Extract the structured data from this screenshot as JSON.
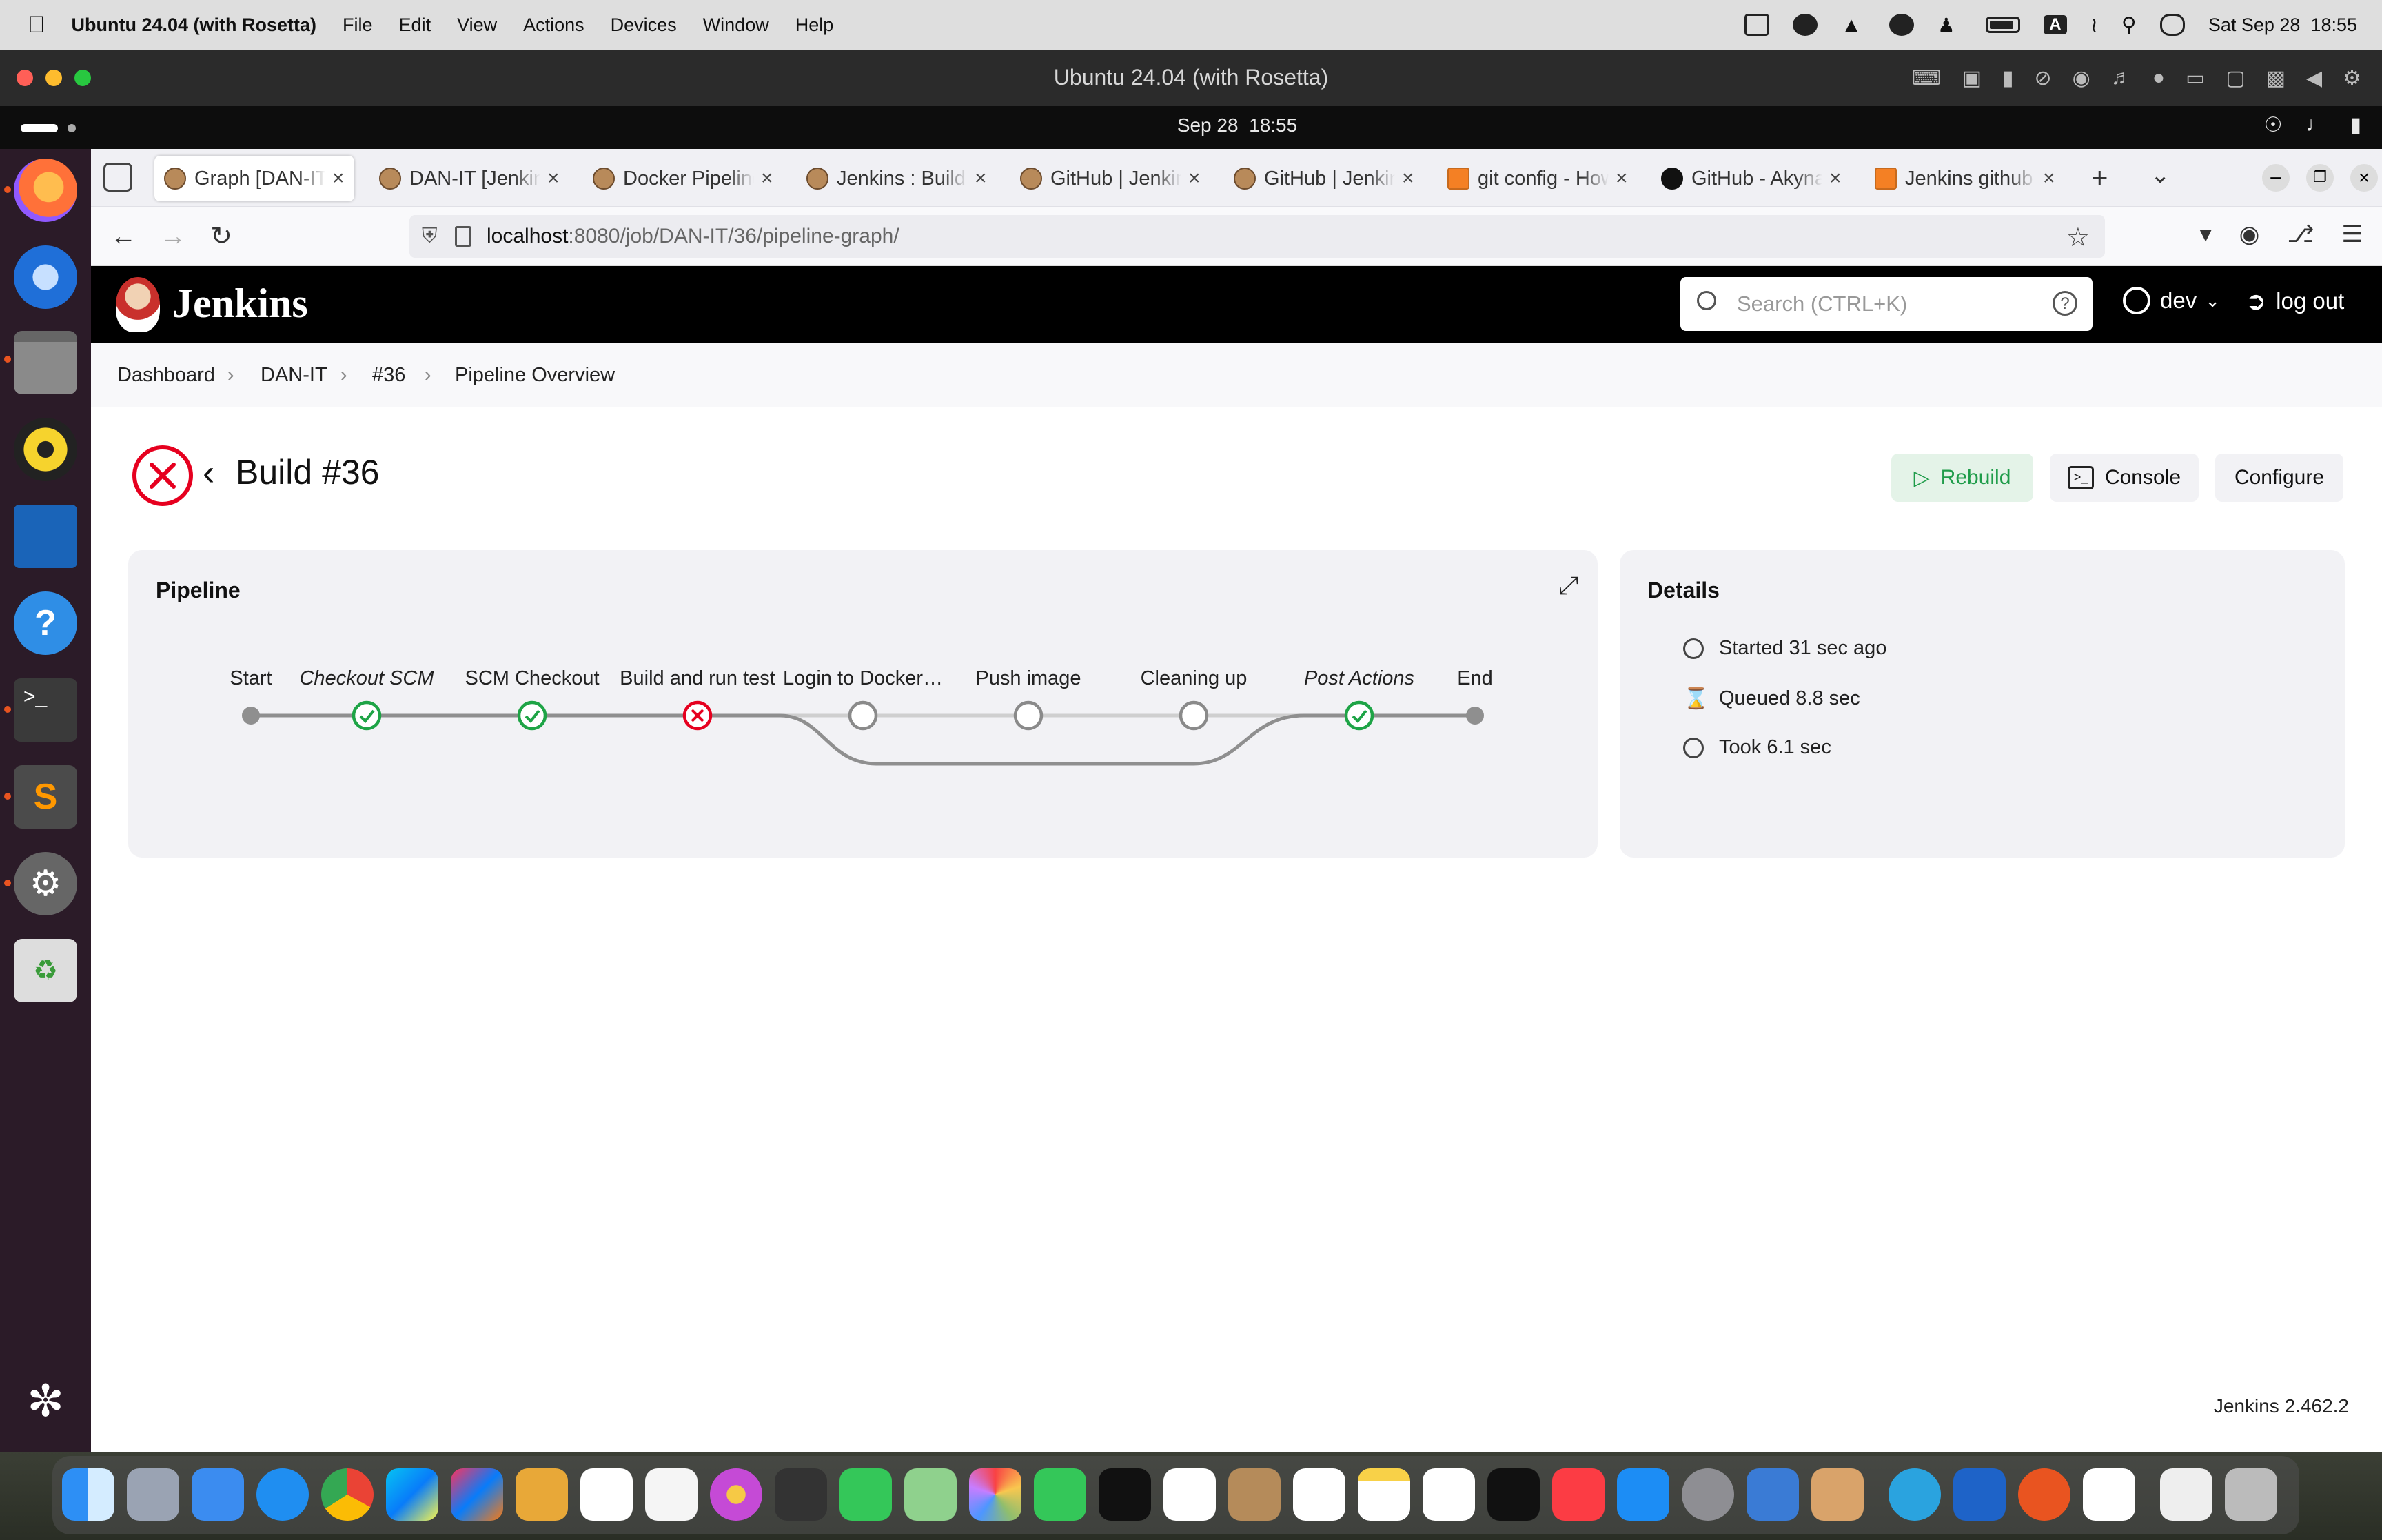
{
  "mac_menubar": {
    "app_name": "Ubuntu 24.04 (with Rosetta)",
    "menus": [
      "File",
      "Edit",
      "View",
      "Actions",
      "Devices",
      "Window",
      "Help"
    ],
    "clock": "Sat Sep 28  18:55",
    "input_badge": "A"
  },
  "vm_window": {
    "title": "Ubuntu 24.04 (with Rosetta)"
  },
  "ubuntu_topbar": {
    "clock": "Sep 28  18:55"
  },
  "browser": {
    "tabs": [
      {
        "title": "Graph [DAN-IT",
        "active": true
      },
      {
        "title": "DAN-IT [Jenkins"
      },
      {
        "title": "Docker Pipeline"
      },
      {
        "title": "Jenkins : Build"
      },
      {
        "title": "GitHub | Jenkins"
      },
      {
        "title": "GitHub | Jenkins"
      },
      {
        "title": "git config - How"
      },
      {
        "title": "GitHub - Akyna"
      },
      {
        "title": "Jenkins github"
      }
    ],
    "url_host": "localhost",
    "url_rest": ":8080/job/DAN-IT/36/pipeline-graph/"
  },
  "jenkins": {
    "brand": "Jenkins",
    "search_placeholder": "Search (CTRL+K)",
    "user": "dev",
    "logout": "log out",
    "breadcrumbs": [
      "Dashboard",
      "DAN-IT",
      "#36",
      "Pipeline Overview"
    ],
    "build_title": "Build #36",
    "buttons": {
      "rebuild": "Rebuild",
      "console": "Console",
      "configure": "Configure"
    },
    "pipeline": {
      "title": "Pipeline",
      "stages": [
        {
          "label": "Start",
          "status": "start",
          "italic": false
        },
        {
          "label": "Checkout SCM",
          "status": "success",
          "italic": true
        },
        {
          "label": "SCM Checkout",
          "status": "success",
          "italic": false
        },
        {
          "label": "Build and run test",
          "status": "failed",
          "italic": false
        },
        {
          "label": "Login to Docker…",
          "status": "skipped",
          "italic": false
        },
        {
          "label": "Push image",
          "status": "skipped",
          "italic": false
        },
        {
          "label": "Cleaning up",
          "status": "skipped",
          "italic": false
        },
        {
          "label": "Post Actions",
          "status": "success",
          "italic": true
        },
        {
          "label": "End",
          "status": "end",
          "italic": false
        }
      ]
    },
    "details": {
      "title": "Details",
      "started": "Started 31 sec ago",
      "queued": "Queued 8.8 sec",
      "took": "Took 6.1 sec"
    },
    "version": "Jenkins 2.462.2"
  },
  "colors": {
    "success": "#1ea446",
    "failed": "#e6001f",
    "skipped": "#9a9a9a",
    "rebuild_bg": "#e4f3e8",
    "rebuild_fg": "#1f9c4a"
  }
}
